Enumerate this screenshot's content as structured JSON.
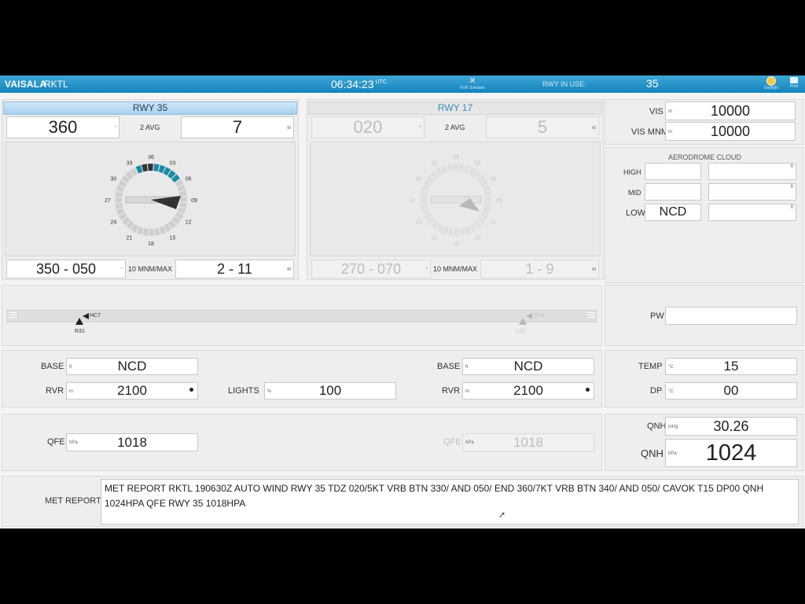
{
  "header": {
    "brand": "VAISALA",
    "station": "RKTL",
    "time": "06:34:23",
    "time_zone": "UTC",
    "rwy_in_use_label": "RWY IN USE:",
    "rwy_in_use_value": "35",
    "kvr_label": "KVR Somatee",
    "daylight_label": "Daylight",
    "print_label": "Print"
  },
  "rwy35": {
    "title": "RWY 35",
    "dir": "360",
    "avg_label": "2 AVG",
    "speed": "7",
    "range": "350 - 050",
    "mnm_label": "10 MNM/MAX",
    "minmax": "2 - 11",
    "dial_labels": [
      "24",
      "27",
      "30",
      "21",
      "33",
      "18",
      "36",
      "15",
      "03",
      "12",
      "06",
      "09"
    ]
  },
  "rwy17": {
    "title": "RWY 17",
    "dir": "020",
    "avg_label": "2 AVG",
    "speed": "5",
    "range": "270 - 070",
    "mnm_label": "10 MNM/MAX",
    "minmax": "1 - 9",
    "dial_labels": [
      "24",
      "27",
      "30",
      "21",
      "33",
      "18",
      "36",
      "15",
      "03",
      "12",
      "06",
      "09"
    ]
  },
  "units": {
    "deg": "°",
    "kt": "kt",
    "m": "m",
    "ft": "ft",
    "pct": "%",
    "degc": "°C",
    "hpa": "hPa",
    "inhg": "inHg"
  },
  "vis": {
    "vis_label": "VIS",
    "vis_value": "10000",
    "mnm_label": "VIS MNM",
    "mnm_value": "10000"
  },
  "cloud": {
    "title": "AERODROME CLOUD",
    "high_label": "HIGH",
    "mid_label": "MID",
    "low_label": "LOW",
    "low_value": "NCD"
  },
  "runway_strip": {
    "left_marker": "HC7",
    "left_sensor": "R31",
    "right_marker": "TCH",
    "right_sensor": "L02"
  },
  "pw": {
    "label": "PW",
    "value": ""
  },
  "left": {
    "base_label": "BASE",
    "base_value": "NCD",
    "rvr_label": "RVR",
    "rvr_value": "2100",
    "qfe_label": "QFE",
    "qfe_value": "1018"
  },
  "lights": {
    "label": "LIGHTS",
    "value": "100"
  },
  "right": {
    "base_label": "BASE",
    "base_value": "NCD",
    "rvr_label": "RVR",
    "rvr_value": "2100",
    "qfe_label": "QFE",
    "qfe_value": "1018"
  },
  "temp": {
    "label": "TEMP",
    "value": "15",
    "dp_label": "DP",
    "dp_value": "00"
  },
  "qnh": {
    "label1": "QNH",
    "inhg": "30.26",
    "label2": "QNH",
    "hpa": "1024"
  },
  "met": {
    "label": "MET REPORT",
    "text": "MET REPORT RKTL 190630Z AUTO WIND RWY 35 TDZ 020/5KT VRB BTN 330/ AND 050/ END 360/7KT VRB BTN 340/ AND 050/ CAVOK T15 DP00 QNH 1024HPA QFE RWY 35 1018HPA"
  },
  "colors": {
    "accent": "#1283bd",
    "teal": "#1b8aa6",
    "dial_gray": "#cfcfcf"
  }
}
